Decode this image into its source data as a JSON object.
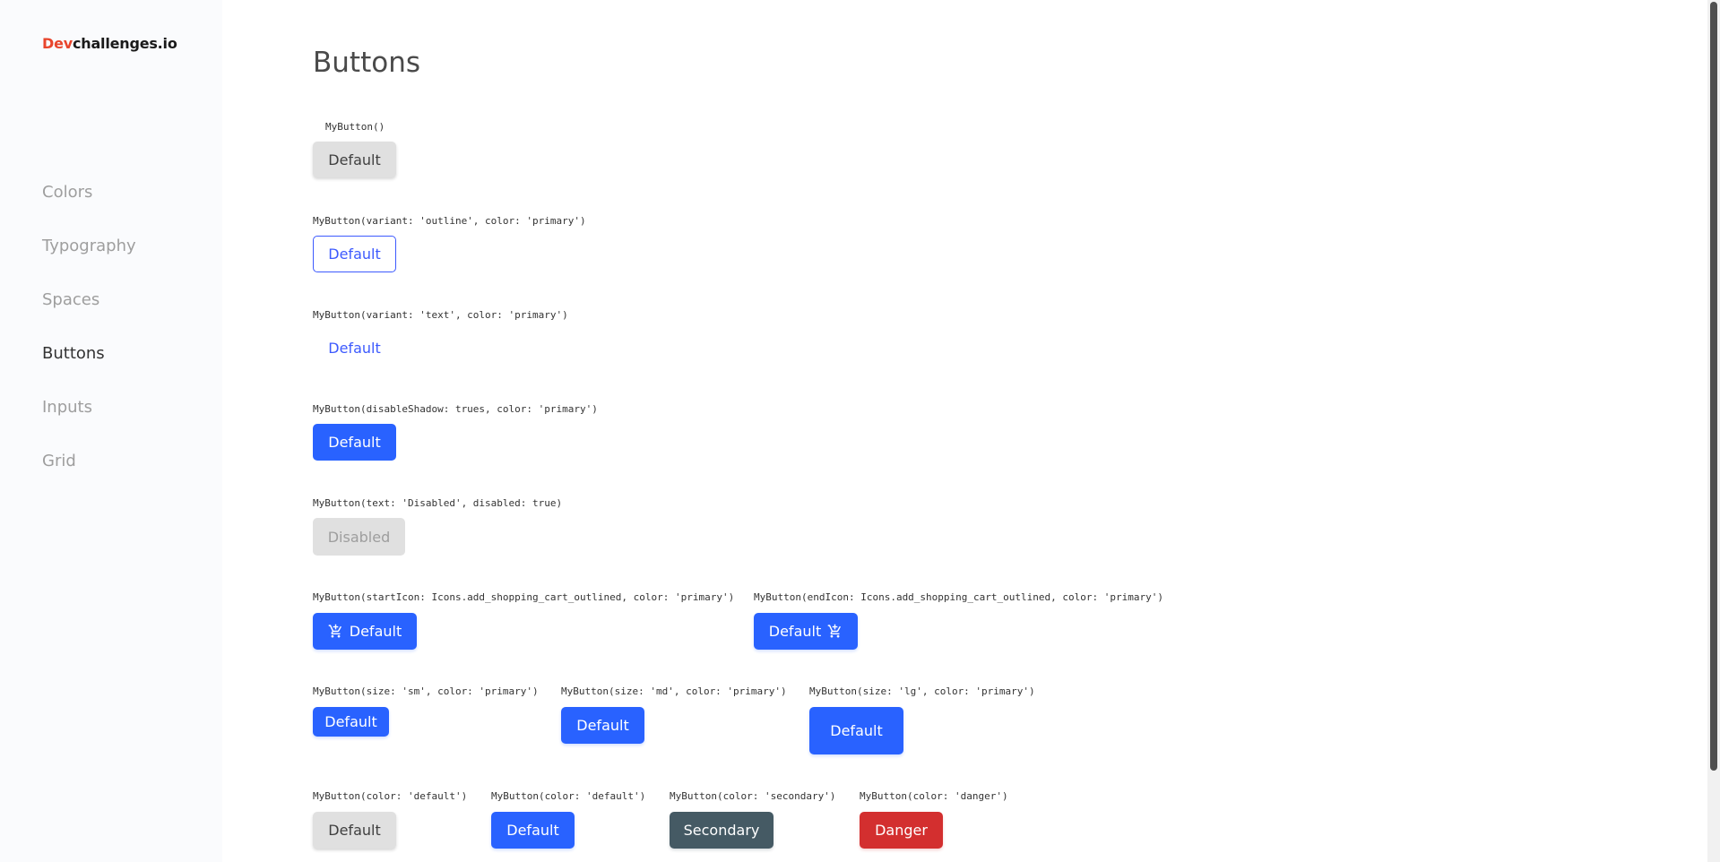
{
  "logo": {
    "accent": "Dev",
    "rest": "challenges.io"
  },
  "nav": {
    "items": [
      {
        "label": "Colors"
      },
      {
        "label": "Typography"
      },
      {
        "label": "Spaces"
      },
      {
        "label": "Buttons"
      },
      {
        "label": "Inputs"
      },
      {
        "label": "Grid"
      }
    ]
  },
  "main": {
    "title": "Buttons",
    "examples": [
      {
        "code": "MyButton()",
        "label": "Default"
      },
      {
        "code": "MyButton(variant: 'outline', color: 'primary')",
        "label": "Default"
      },
      {
        "code": "MyButton(variant: 'text', color: 'primary')",
        "label": "Default"
      },
      {
        "code": "MyButton(disableShadow: trues, color: 'primary')",
        "label": "Default"
      },
      {
        "code": "MyButton(text: 'Disabled', disabled: true)",
        "label": "Disabled"
      },
      {
        "code": "MyButton(startIcon: Icons.add_shopping_cart_outlined, color: 'primary')",
        "label": "Default",
        "icon": "add-shopping-cart-icon"
      },
      {
        "code": "MyButton(endIcon: Icons.add_shopping_cart_outlined, color: 'primary')",
        "label": "Default",
        "icon": "add-shopping-cart-icon"
      },
      {
        "code": "MyButton(size: 'sm', color: 'primary')",
        "label": "Default"
      },
      {
        "code": "MyButton(size: 'md', color: 'primary')",
        "label": "Default"
      },
      {
        "code": "MyButton(size: 'lg', color: 'primary')",
        "label": "Default"
      },
      {
        "code": "MyButton(color: 'default')",
        "label": "Default"
      },
      {
        "code": "MyButton(color: 'default')",
        "label": "Default"
      },
      {
        "code": "MyButton(color: 'secondary')",
        "label": "Secondary"
      },
      {
        "code": "MyButton(color: 'danger')",
        "label": "Danger"
      }
    ]
  },
  "colors": {
    "primary": "#2962ff",
    "default": "#e0e0e0",
    "secondary": "#455a64",
    "danger": "#d32f2f",
    "logo_accent": "#e8452c"
  }
}
